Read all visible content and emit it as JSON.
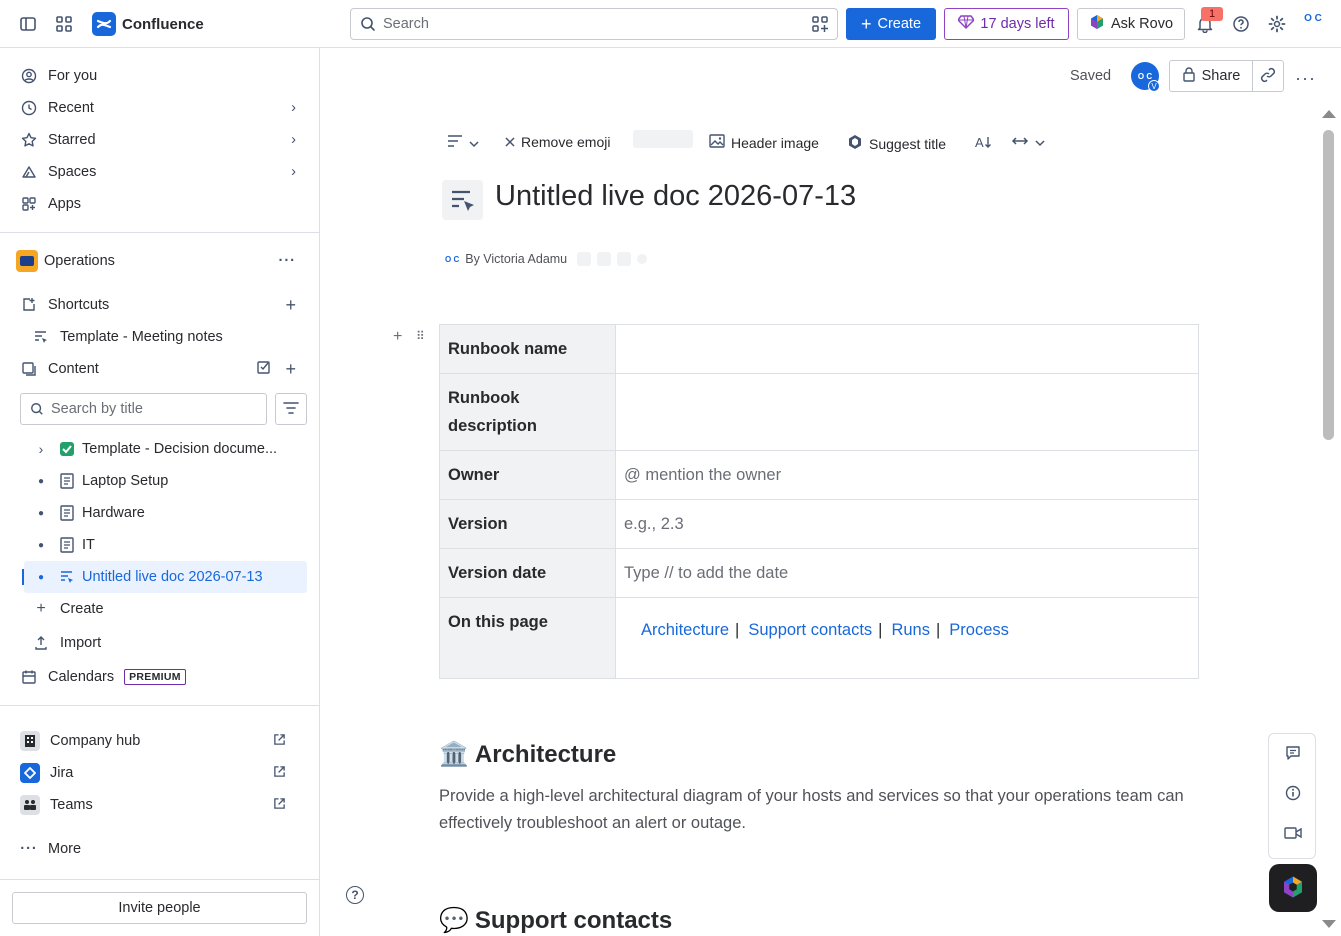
{
  "topbar": {
    "app_name": "Confluence",
    "search_placeholder": "Search",
    "create_label": "Create",
    "trial_label": "17 days left",
    "rovo_label": "Ask Rovo",
    "notification_count": "1",
    "org_logo_text": "O C"
  },
  "sidebar": {
    "nav": [
      {
        "label": "For you",
        "icon": "user-circle-icon"
      },
      {
        "label": "Recent",
        "icon": "clock-icon"
      },
      {
        "label": "Starred",
        "icon": "star-icon"
      },
      {
        "label": "Spaces",
        "icon": "spaces-icon"
      },
      {
        "label": "Apps",
        "icon": "apps-icon"
      }
    ],
    "space_name": "Operations",
    "shortcuts_label": "Shortcuts",
    "shortcut_item": "Template - Meeting notes",
    "content_label": "Content",
    "tree_search_placeholder": "Search by title",
    "tree": [
      {
        "label": "Template - Decision docume...",
        "icon": "check-emoji-icon"
      },
      {
        "label": "Laptop Setup",
        "icon": "page-icon"
      },
      {
        "label": "Hardware",
        "icon": "page-icon"
      },
      {
        "label": "IT",
        "icon": "page-icon"
      },
      {
        "label": "Untitled live doc 2026-07-13",
        "icon": "live-doc-icon"
      }
    ],
    "create_label": "Create",
    "import_label": "Import",
    "calendars_label": "Calendars",
    "premium_badge": "PREMIUM",
    "apps": [
      {
        "label": "Company hub"
      },
      {
        "label": "Jira"
      },
      {
        "label": "Teams"
      }
    ],
    "more_label": "More",
    "invite_label": "Invite people"
  },
  "header": {
    "saved_label": "Saved",
    "avatar_initials": "O C",
    "avatar_badge": "V",
    "share_label": "Share"
  },
  "toolbar": {
    "remove_emoji": "Remove emoji",
    "header_image": "Header image",
    "suggest_title": "Suggest title"
  },
  "doc": {
    "title": "Untitled live doc 2026-07-13",
    "byline": "By Victoria Adamu",
    "byline_avatar": "O C",
    "table": {
      "rows": [
        {
          "label": "Runbook name",
          "value": ""
        },
        {
          "label": "Runbook description",
          "value": ""
        },
        {
          "label": "Owner",
          "value": "@ mention the owner"
        },
        {
          "label": "Version",
          "value": "e.g., 2.3"
        },
        {
          "label": "Version date",
          "value": "Type // to add the date"
        },
        {
          "label": "On this page",
          "value": ""
        }
      ],
      "toc_links": [
        "Architecture",
        "Support contacts",
        "Runs",
        "Process"
      ]
    },
    "section1": {
      "emoji": "🏛️",
      "heading": "Architecture"
    },
    "section1_body": "Provide a high-level architectural diagram of your hosts and services so that your operations team can effectively troubleshoot an alert or outage.",
    "section2": {
      "emoji": "💬",
      "heading": "Support contacts"
    }
  },
  "colors": {
    "accent": "#1868db",
    "trial": "#8f42c4",
    "border": "#dcdfe4"
  }
}
